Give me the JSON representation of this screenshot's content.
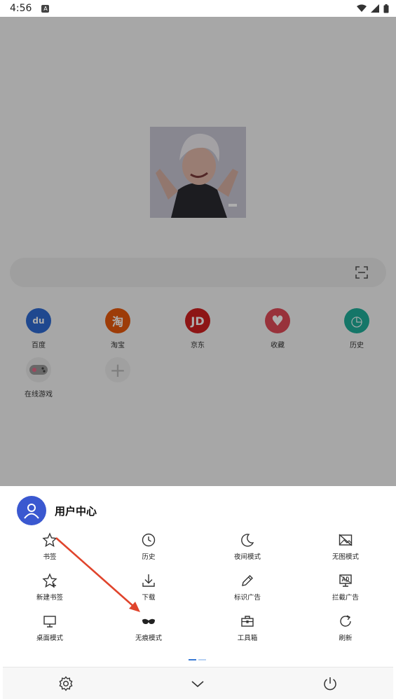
{
  "status_bar": {
    "time": "4:56",
    "notif_icon": "A"
  },
  "shortcuts": [
    {
      "label": "百度",
      "glyph": "du",
      "color": "#2f6bd3",
      "icon": "baidu-paw-icon"
    },
    {
      "label": "淘宝",
      "glyph": "淘",
      "color": "#e8590c",
      "icon": "taobao-icon"
    },
    {
      "label": "京东",
      "glyph": "JD",
      "color": "#d01f1f",
      "icon": "jd-icon"
    },
    {
      "label": "收藏",
      "glyph": "♥",
      "color": "#e14a57",
      "icon": "heart-icon"
    },
    {
      "label": "历史",
      "glyph": "◷",
      "color": "#1faf9a",
      "icon": "clock-icon"
    },
    {
      "label": "在线游戏",
      "glyph": "",
      "color": "#e9e9e9",
      "icon": "gamepad-icon"
    },
    {
      "label": "",
      "glyph": "+",
      "color": "#ececec",
      "icon": "add-icon"
    }
  ],
  "sheet": {
    "user_title": "用户中心",
    "menu": [
      {
        "label": "书签",
        "icon": "star-icon"
      },
      {
        "label": "历史",
        "icon": "clock-icon"
      },
      {
        "label": "夜间模式",
        "icon": "moon-icon"
      },
      {
        "label": "无图模式",
        "icon": "no-image-icon"
      },
      {
        "label": "新建书签",
        "icon": "star-plus-icon"
      },
      {
        "label": "下载",
        "icon": "download-icon"
      },
      {
        "label": "标识广告",
        "icon": "pencil-icon"
      },
      {
        "label": "拦截广告",
        "icon": "block-ad-icon"
      },
      {
        "label": "桌面模式",
        "icon": "monitor-icon"
      },
      {
        "label": "无痕模式",
        "icon": "mask-icon"
      },
      {
        "label": "工具箱",
        "icon": "toolbox-icon"
      },
      {
        "label": "刷新",
        "icon": "refresh-icon"
      }
    ]
  },
  "colors": {
    "accent": "#3a58d0",
    "arrow": "#e0442c"
  }
}
